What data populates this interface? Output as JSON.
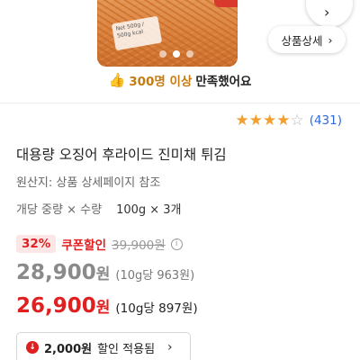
{
  "product_image": {
    "bag_label": "Net 500g / 500g kcal",
    "carousel": {
      "total": 3,
      "active": 2
    }
  },
  "actions": {
    "share_chevron": "›",
    "detail_button_label": "상품상세",
    "detail_chevron": "›"
  },
  "satisfaction": {
    "icon": "thumbs-up-icon",
    "icon_glyph": "👍",
    "count": "300명 이상",
    "suffix": "만족했어요"
  },
  "rating": {
    "stars_value": 4,
    "stars_max": 5,
    "star_color": "#f0a030",
    "review_count": "(431)"
  },
  "product": {
    "title": "대용량 오징어 후라이드 진미채 튀김",
    "origin": "원산지: 상품 상세페이지 참조",
    "unit_label": "개당 중량 × 수량",
    "unit_value": "100g × 3개"
  },
  "pricing": {
    "discount_percent": "32%",
    "coupon_label": "쿠폰할인",
    "original_price": "39,900원",
    "info_icon": "ⓘ",
    "sale_price": "28,900",
    "sale_currency": "원",
    "sale_unit_price": "(10g당 963원)",
    "coupon_price": "26,900",
    "coupon_currency": "원",
    "coupon_unit_price": "(10g당 897원)",
    "accent_color": "#e02020"
  },
  "discount_button": {
    "icon": "arrow-down-icon",
    "icon_glyph": "↓",
    "amount": "2,000원",
    "label": "할인 적용됨",
    "chevron": "›"
  }
}
